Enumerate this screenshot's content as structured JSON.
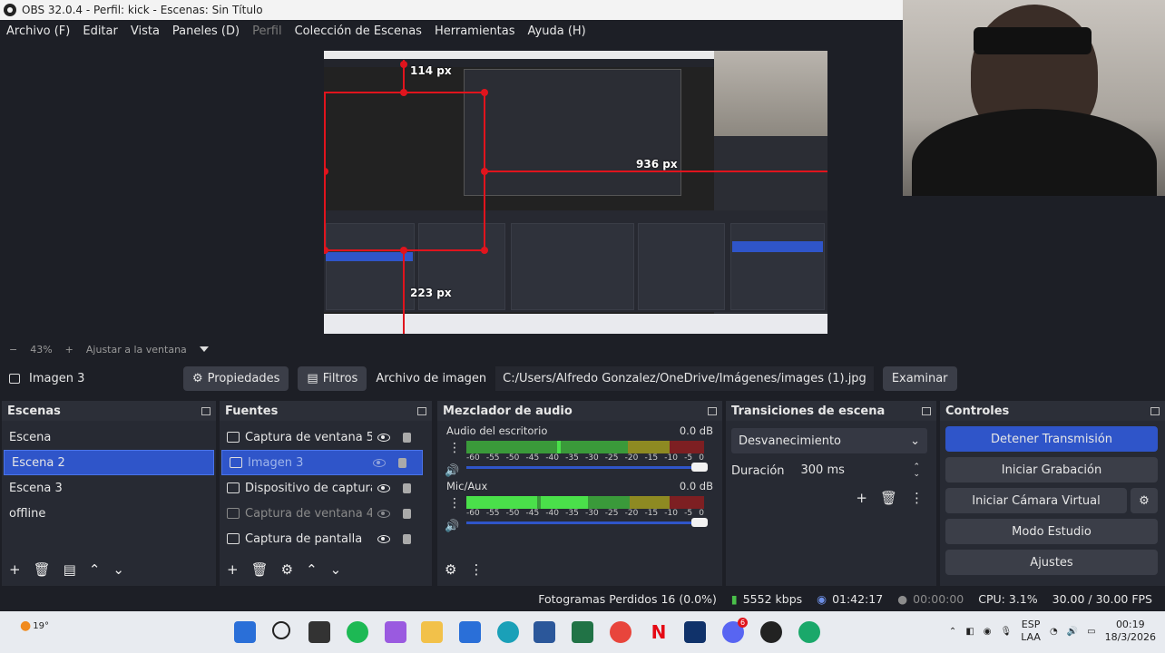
{
  "window": {
    "title": "OBS 32.0.4 - Perfil: kick - Escenas: Sin Título"
  },
  "menu": [
    "Archivo (F)",
    "Editar",
    "Vista",
    "Paneles (D)",
    "Perfil",
    "Colección de Escenas",
    "Herramientas",
    "Ayuda (H)"
  ],
  "preview": {
    "labels": {
      "top": "114 px",
      "right": "936 px",
      "bottom": "223 px"
    }
  },
  "zoom": {
    "minus": "−",
    "level": "43%",
    "plus": "+",
    "fit": "Ajustar a la ventana"
  },
  "propbar": {
    "source_name": "Imagen 3",
    "properties": "Propiedades",
    "filters": "Filtros",
    "file_label": "Archivo de imagen",
    "file_path": "C:/Users/Alfredo Gonzalez/OneDrive/Imágenes/images (1).jpg",
    "browse": "Examinar"
  },
  "scenes": {
    "title": "Escenas",
    "items": [
      "Escena",
      "Escena 2",
      "Escena 3",
      "offline"
    ],
    "selected": "Escena 2"
  },
  "sources": {
    "title": "Fuentes",
    "items": [
      "Captura de ventana 5",
      "Imagen 3",
      "Dispositivo de captura de vídeo",
      "Captura de ventana 4",
      "Captura de pantalla"
    ]
  },
  "mixer": {
    "title": "Mezclador de audio",
    "channels": [
      {
        "name": "Audio del escritorio",
        "db": "0.0 dB"
      },
      {
        "name": "Mic/Aux",
        "db": "0.0 dB"
      }
    ],
    "scale": [
      "-60",
      "-55",
      "-50",
      "-45",
      "-40",
      "-35",
      "-30",
      "-25",
      "-20",
      "-15",
      "-10",
      "-5",
      "0"
    ]
  },
  "transitions": {
    "title": "Transiciones de escena",
    "selected": "Desvanecimiento",
    "duration_label": "Duración",
    "duration_value": "300 ms"
  },
  "controls": {
    "title": "Controles",
    "stop_stream": "Detener Transmisión",
    "start_recording": "Iniciar Grabación",
    "virtual_cam": "Iniciar Cámara Virtual",
    "studio_mode": "Modo Estudio",
    "settings": "Ajustes"
  },
  "status": {
    "dropped": "Fotogramas Perdidos 16 (0.0%)",
    "bitrate": "5552 kbps",
    "stream_time": "01:42:17",
    "rec_time": "00:00:00",
    "cpu": "CPU: 3.1%",
    "fps": "30.00 / 30.00 FPS"
  },
  "taskbar": {
    "weather": "19°",
    "lang": "ESP",
    "lang2": "LAA",
    "time": "00:19",
    "date": "18/3/2026",
    "badge": "6"
  },
  "colors": {
    "accent": "#2f55c9",
    "guide_red": "#e0141d",
    "bg": "#1d1f26",
    "dock": "#272a33"
  }
}
